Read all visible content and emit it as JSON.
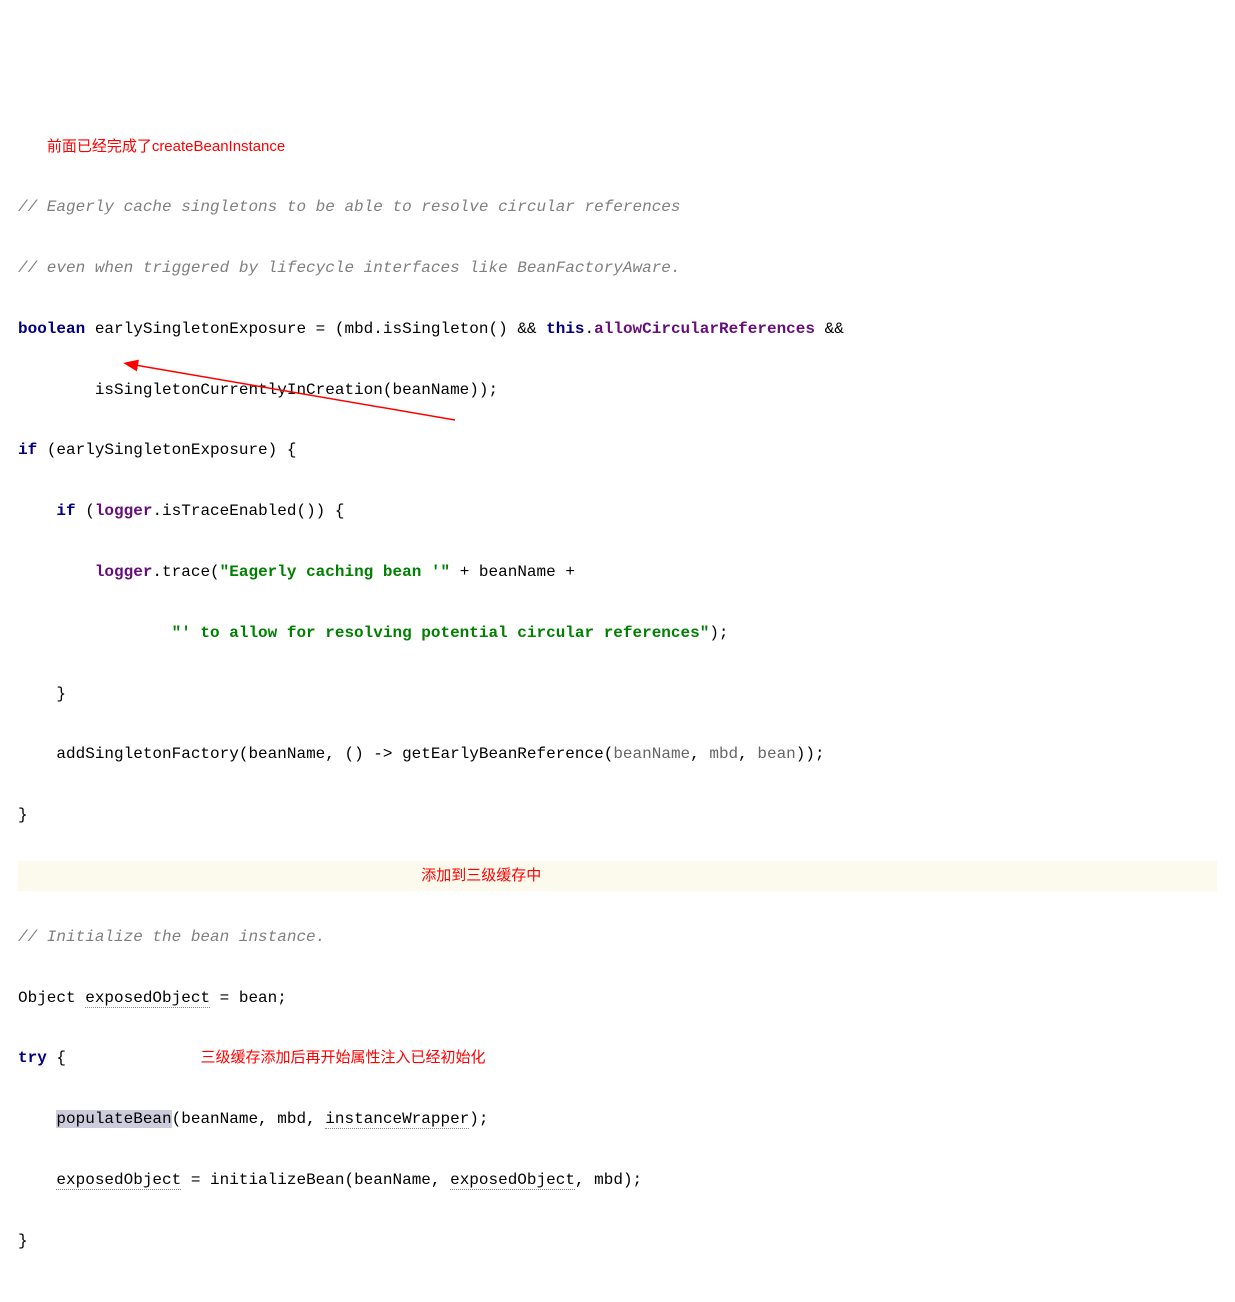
{
  "annotations": {
    "top_note": "前面已经完成了createBeanInstance",
    "mid_note": "添加到三级缓存中",
    "bottom_note": "三级缓存添加后再开始属性注入已经初始化"
  },
  "code": {
    "comment1": "// Eagerly cache singletons to be able to resolve circular references",
    "comment2": "// even when triggered by lifecycle interfaces like BeanFactoryAware.",
    "kw_boolean": "boolean",
    "var_ese": "earlySingletonExposure",
    "op_assign": " = (",
    "mbd": "mbd",
    "dot": ".",
    "isSingleton": "isSingleton",
    "call_close": "()",
    "andand": " && ",
    "kw_this": "this",
    "allowCircular": "allowCircularReferences",
    "line_end_amp": " &&",
    "isSingletonCurrently": "isSingletonCurrentlyInCreation",
    "open_paren": "(",
    "close_paren": ")",
    "beanName": "beanName",
    "semi": ";",
    "kw_if": "if",
    "ese": "earlySingletonExposure",
    "open_brace": " {",
    "close_brace": "}",
    "logger": "logger",
    "isTraceEnabled": "isTraceEnabled",
    "trace": "trace",
    "str1": "\"Eagerly caching bean '\"",
    "plus": " + ",
    "str2": "\"' to allow for resolving potential circular references\"",
    "addSingletonFactory": "addSingletonFactory",
    "comma_sp": ", ",
    "lambda": "() -> ",
    "getEarlyBeanReference": "getEarlyBeanReference",
    "mbd2": "mbd",
    "bean": "bean",
    "comment3": "// Initialize the bean instance.",
    "Object": "Object",
    "exposedObject": "exposedObject",
    "eq_bean": " = bean;",
    "kw_try": "try",
    "populateBean": "populateBean",
    "instanceWrapper": "instanceWrapper",
    "initializeBean": "initializeBean",
    "eq_init": " = "
  }
}
